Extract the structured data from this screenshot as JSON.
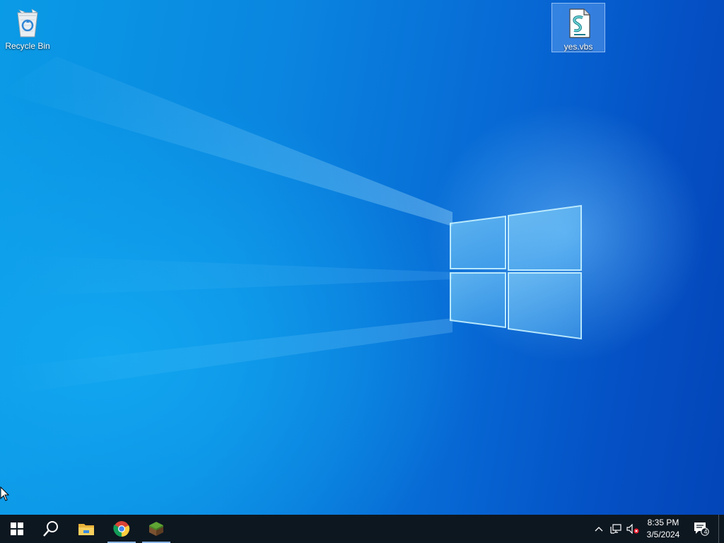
{
  "desktop": {
    "icons": [
      {
        "label": "Recycle Bin",
        "icon": "recycle-bin-icon"
      },
      {
        "label": "yes.vbs",
        "icon": "vbs-script-icon",
        "selected": true
      }
    ]
  },
  "taskbar": {
    "buttons": [
      {
        "icon": "windows-start-icon"
      },
      {
        "icon": "search-icon"
      },
      {
        "icon": "file-explorer-icon"
      },
      {
        "icon": "chrome-icon",
        "running": true
      },
      {
        "icon": "minecraft-icon",
        "running": true
      }
    ],
    "tray": {
      "icons": [
        "chevron-up-icon",
        "network-icon",
        "volume-muted-icon"
      ],
      "time": "8:35 PM",
      "date": "3/5/2024",
      "notifications_count": "4"
    }
  },
  "colors": {
    "taskbar": "#0d1720",
    "desktop_accent": "#0a86e0",
    "running_indicator": "#8ab4e4"
  }
}
